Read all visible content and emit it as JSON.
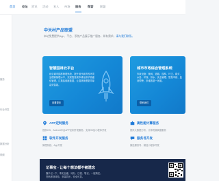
{
  "nav": {
    "items": [
      {
        "label": "首页"
      },
      {
        "label": "论坛"
      },
      {
        "label": "资讯"
      },
      {
        "label": "活动"
      },
      {
        "label": "名人"
      },
      {
        "label": "市场"
      },
      {
        "label": "服务"
      },
      {
        "label": "帮客"
      },
      {
        "label": "联盟"
      }
    ]
  },
  "sidebar": {
    "labels": [
      "服务",
      "行业开发",
      "数据分析",
      "视频"
    ]
  },
  "main": {
    "title": "中关村产品联盟",
    "desc_prefix": "本站免费提供App、平台、系统产品展示推广服务，如有需求，",
    "desc_link": "请与我们联系。"
  },
  "cards": [
    {
      "title": "智慧园林云平台",
      "body": "综合城市园林管理系统，提升现代城市的环境治理和管理水平，实现智慧城市绿化养护精细化管理，汇集各维度数据，让园林管理更简单高效智能。",
      "button": "查看更多"
    },
    {
      "title": "城市市政综合管理系统",
      "body": "市政设施：管网、道路、园林、环卫、路灯、水务、环保、排水、安全管理、智慧市政、监测预警，多维数据一张图。",
      "button": "联系我们"
    }
  ],
  "services": [
    {
      "title": "APP定制服务",
      "desc": "提供iOS、Android平台APP定制开发服务，支持H5及小程序开发"
    },
    {
      "title": "高性能计算服务",
      "desc": "提供大数据分析，计算资源调度服务"
    },
    {
      "title": "软件开发服务",
      "desc": "管理系统、App开发"
    },
    {
      "title": "服务号开发",
      "desc": "微信服务号、微信小程序开发"
    }
  ],
  "banner": {
    "title": "记事宝 - 让每个想法都不被遗忘",
    "line1": "随手记一下，事无巨细，待办、日程、笔记，一键搞定。",
    "line2": "扫码即刻体验，多端同步，安全可靠。"
  },
  "colors": {
    "accent": "#1f7ad8",
    "card_bg": "#1487d6",
    "banner_bg": "#17284a"
  }
}
